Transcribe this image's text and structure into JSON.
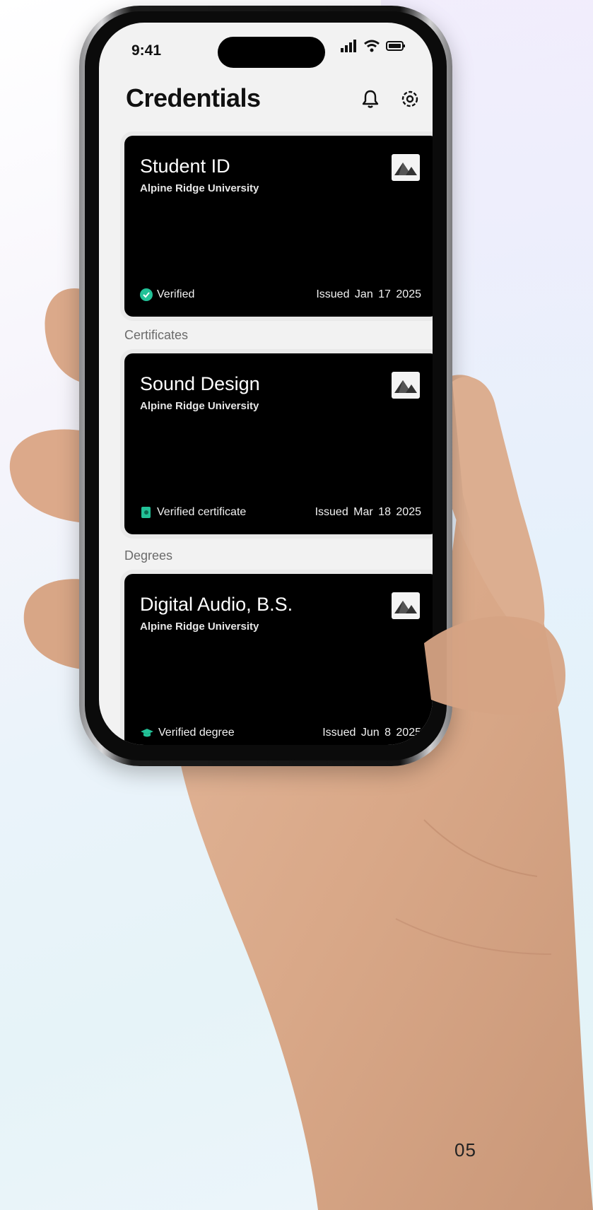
{
  "status_bar": {
    "time": "9:41"
  },
  "header": {
    "title": "Credentials"
  },
  "cards": [
    {
      "title": "Student ID",
      "issuer": "Alpine Ridge University",
      "badge": "Verified",
      "issued": "Issued  Jan 17 2025"
    },
    {
      "title": "Sound Design",
      "issuer": "Alpine Ridge University",
      "badge": "Verified certificate",
      "issued": "Issued  Mar 18 2025"
    },
    {
      "title": "Digital Audio, B.S.",
      "issuer": "Alpine Ridge University",
      "badge": "Verified degree",
      "issued": "Issued  Jun 8 2025"
    }
  ],
  "sections": {
    "certificates": "Certificates",
    "degrees": "Degrees"
  },
  "page_number": "05",
  "colors": {
    "accent": "#22c197",
    "card_bg": "#000000",
    "screen_bg": "#f2f2f2"
  },
  "icons": [
    "bell-icon",
    "gear-icon",
    "signal-icon",
    "wifi-icon",
    "battery-icon",
    "mountain-logo-icon",
    "check-circle-icon",
    "certificate-icon",
    "graduation-cap-icon"
  ]
}
